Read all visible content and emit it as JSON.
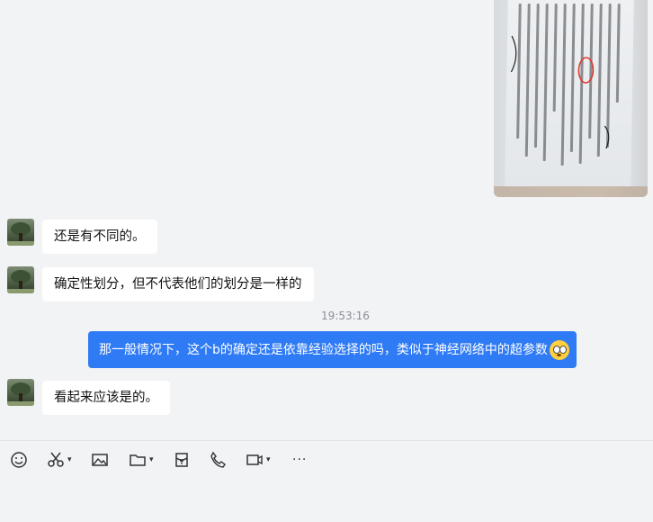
{
  "messages": [
    {
      "sender": "other",
      "text": "还是有不同的。"
    },
    {
      "sender": "other",
      "text": "确定性划分，但不代表他们的划分是一样的"
    },
    {
      "sender": "me",
      "text": "那一般情况下，这个b的确定还是依靠经验选择的吗，类似于神经网络中的超参数"
    },
    {
      "sender": "other",
      "text": "看起来应该是的。"
    }
  ],
  "timestamp": "19:53:16",
  "toolbar": {
    "icons": [
      "emoji-icon",
      "scissors-icon",
      "image-icon",
      "folder-icon",
      "redpacket-icon",
      "phone-icon",
      "video-icon",
      "more-icon"
    ],
    "more_label": "···"
  },
  "colors": {
    "bubble_mine": "#2f7bf5",
    "bubble_other": "#ffffff",
    "background": "#f2f3f5"
  }
}
